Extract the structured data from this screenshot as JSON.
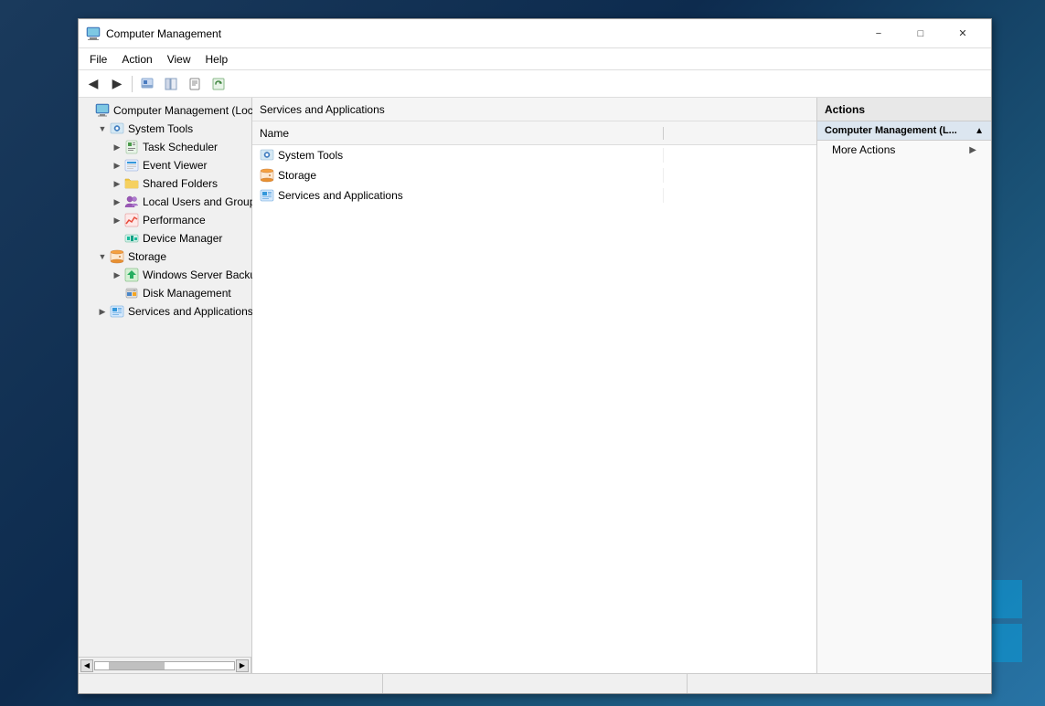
{
  "desktop": {
    "background": "#1a3a5c"
  },
  "window": {
    "title": "Computer Management",
    "icon": "computer-management-icon"
  },
  "menu": {
    "items": [
      "File",
      "Action",
      "View",
      "Help"
    ]
  },
  "toolbar": {
    "buttons": [
      {
        "name": "back-button",
        "label": "◀",
        "tooltip": "Back"
      },
      {
        "name": "forward-button",
        "label": "▶",
        "tooltip": "Forward"
      },
      {
        "name": "up-button",
        "label": "⬆",
        "tooltip": "Up"
      },
      {
        "name": "show-hide-button",
        "label": "⊞",
        "tooltip": "Show/Hide"
      },
      {
        "name": "properties-button",
        "label": "🗎",
        "tooltip": "Properties"
      },
      {
        "name": "refresh-button",
        "label": "⟳",
        "tooltip": "Refresh"
      }
    ]
  },
  "tree": {
    "items": [
      {
        "id": "root",
        "label": "Computer Management (Local",
        "level": 0,
        "expandable": false,
        "expanded": true,
        "icon": "computer-icon"
      },
      {
        "id": "system-tools",
        "label": "System Tools",
        "level": 1,
        "expandable": true,
        "expanded": true,
        "icon": "gear-icon"
      },
      {
        "id": "task-scheduler",
        "label": "Task Scheduler",
        "level": 2,
        "expandable": true,
        "expanded": false,
        "icon": "task-icon"
      },
      {
        "id": "event-viewer",
        "label": "Event Viewer",
        "level": 2,
        "expandable": true,
        "expanded": false,
        "icon": "event-icon"
      },
      {
        "id": "shared-folders",
        "label": "Shared Folders",
        "level": 2,
        "expandable": true,
        "expanded": false,
        "icon": "folder-icon"
      },
      {
        "id": "local-users",
        "label": "Local Users and Groups",
        "level": 2,
        "expandable": true,
        "expanded": false,
        "icon": "users-icon"
      },
      {
        "id": "performance",
        "label": "Performance",
        "level": 2,
        "expandable": true,
        "expanded": false,
        "icon": "perf-icon"
      },
      {
        "id": "device-manager",
        "label": "Device Manager",
        "level": 2,
        "expandable": false,
        "expanded": false,
        "icon": "device-icon"
      },
      {
        "id": "storage",
        "label": "Storage",
        "level": 1,
        "expandable": true,
        "expanded": true,
        "icon": "storage-icon"
      },
      {
        "id": "windows-backup",
        "label": "Windows Server Backup",
        "level": 2,
        "expandable": true,
        "expanded": false,
        "icon": "backup-icon"
      },
      {
        "id": "disk-management",
        "label": "Disk Management",
        "level": 2,
        "expandable": false,
        "expanded": false,
        "icon": "disk-icon"
      },
      {
        "id": "services-apps",
        "label": "Services and Applications",
        "level": 1,
        "expandable": true,
        "expanded": false,
        "icon": "services-icon"
      }
    ]
  },
  "center": {
    "column_name": "Name",
    "rows": [
      {
        "name": "System Tools",
        "icon": "system-tools-icon"
      },
      {
        "name": "Storage",
        "icon": "storage-icon"
      },
      {
        "name": "Services and Applications",
        "icon": "services-icon"
      }
    ]
  },
  "breadcrumb": {
    "path": "Services and Applications"
  },
  "actions": {
    "header": "Actions",
    "sections": [
      {
        "title": "Computer Management (L...",
        "expanded": true,
        "items": [
          {
            "label": "More Actions",
            "has_arrow": true
          }
        ]
      }
    ]
  },
  "status": {
    "segments": [
      "",
      "",
      ""
    ]
  }
}
